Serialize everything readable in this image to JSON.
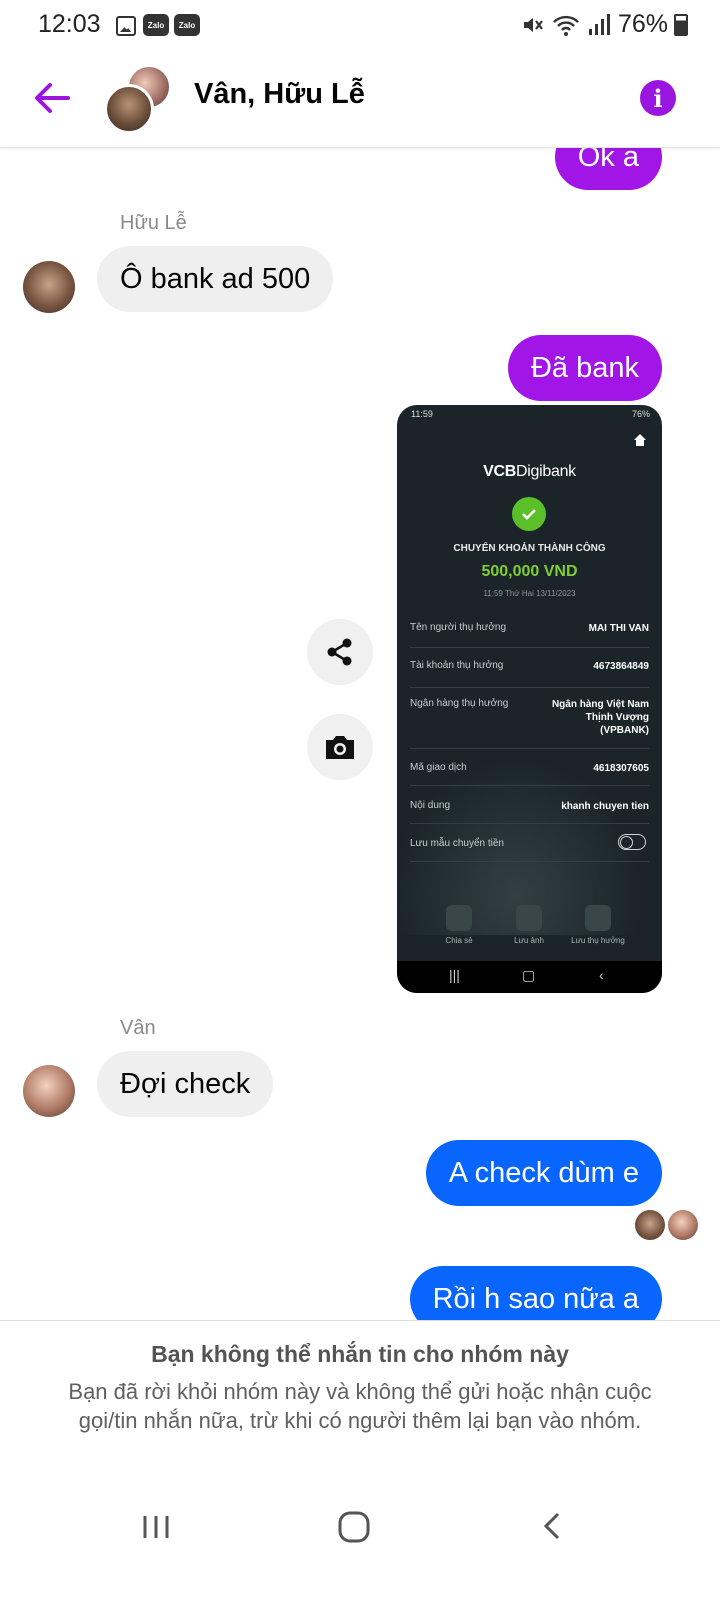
{
  "status_bar": {
    "time": "12:03",
    "app_icons": [
      "gallery-icon",
      "zalo-icon",
      "zalo-icon"
    ],
    "zalo_label": "Zalo",
    "battery": "76%"
  },
  "header": {
    "title": "Vân, Hữu Lễ"
  },
  "messages": {
    "out_ok": "Ok a",
    "sender_huu": "Hữu Lễ",
    "in_bank": "Ô bank ad 500",
    "out_bank": "Đã bank",
    "sender_van": "Vân",
    "in_check": "Đợi check",
    "out_check": "A check dùm e",
    "out_next": "Rồi h sao nữa a"
  },
  "screenshot": {
    "status_time": "11:59",
    "status_battery": "76%",
    "brand_bold": "VCB",
    "brand_rest": "Digibank",
    "status_text": "CHUYỂN KHOẢN THÀNH CÔNG",
    "amount": "500,000 VND",
    "date": "11:59 Thứ Hai 13/11/2023",
    "rows": [
      {
        "label": "Tên người thụ hưởng",
        "value": "MAI THI VAN"
      },
      {
        "label": "Tài khoản thụ hưởng",
        "value": "4673864849"
      },
      {
        "label": "Ngân hàng thụ hưởng",
        "value": "Ngân hàng Việt Nam Thịnh Vượng (VPBANK)"
      },
      {
        "label": "Mã giao dịch",
        "value": "4618307605"
      },
      {
        "label": "Nội dung",
        "value": "khanh chuyen tien"
      },
      {
        "label": "Lưu mẫu chuyển tiền",
        "value": ""
      }
    ],
    "actions": [
      "Chia sẻ",
      "Lưu ảnh",
      "Lưu thụ hưởng"
    ]
  },
  "notice": {
    "title": "Bạn không thể nhắn tin cho nhóm này",
    "body": "Bạn đã rời khỏi nhóm này và không thể gửi hoặc nhận cuộc gọi/tin nhắn nữa, trừ khi có người thêm lại bạn vào nhóm."
  },
  "colors": {
    "accent_purple": "#a116e6",
    "accent_blue": "#0866ff",
    "incoming_bubble": "#efefef",
    "vcb_green": "#7fce38"
  }
}
